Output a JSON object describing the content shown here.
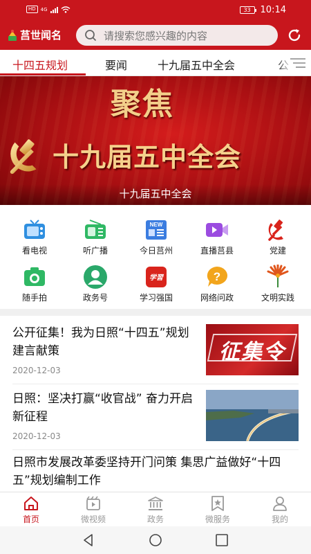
{
  "status_bar": {
    "left_badge": "HD",
    "network": "4G",
    "battery": "33",
    "time": "10:14"
  },
  "header": {
    "app_name": "莒世闻名",
    "search_placeholder": "请搜索您感兴趣的内容"
  },
  "tabs": [
    {
      "label": "十四五规划",
      "active": true
    },
    {
      "label": "要闻",
      "active": false
    },
    {
      "label": "十九届五中全会",
      "active": false
    },
    {
      "label": "公",
      "active": false
    }
  ],
  "banner": {
    "headline": "聚焦",
    "main_text": "十九届五中全会",
    "caption": "十九届五中全会"
  },
  "shortcuts": [
    {
      "label": "看电视",
      "icon": "tv-icon",
      "color": "#2f8fe0"
    },
    {
      "label": "听广播",
      "icon": "radio-icon",
      "color": "#2fb864"
    },
    {
      "label": "今日莒州",
      "icon": "news-icon",
      "color": "#3b7de0",
      "badge": "NEW"
    },
    {
      "label": "直播莒县",
      "icon": "live-video-icon",
      "color": "#9b4ce0"
    },
    {
      "label": "党建",
      "icon": "party-emblem-icon",
      "color": "#d9241c"
    },
    {
      "label": "随手拍",
      "icon": "camera-icon",
      "color": "#2fb864"
    },
    {
      "label": "政务号",
      "icon": "person-icon",
      "color": "#2aa86a"
    },
    {
      "label": "学习强国",
      "icon": "xuexi-icon",
      "color": "#d9241c",
      "badge": "学習"
    },
    {
      "label": "网络问政",
      "icon": "question-icon",
      "color": "#f2a51c"
    },
    {
      "label": "文明实践",
      "icon": "civilization-icon",
      "color": "#e0561c"
    }
  ],
  "news": [
    {
      "title": "公开征集！我为日照“十四五”规划建言献策",
      "date": "2020-12-03",
      "thumb_text": "征集令",
      "thumb": "collection-order-image"
    },
    {
      "title": "日照：坚决打赢“收官战” 奋力开启新征程",
      "date": "2020-12-03",
      "thumb": "coastal-bridge-image"
    },
    {
      "title": "日照市发展改革委坚持开门问策 集思广益做好“十四五”规划编制工作"
    }
  ],
  "bottom_nav": [
    {
      "label": "首页",
      "icon": "home-icon",
      "active": true
    },
    {
      "label": "微视频",
      "icon": "video-clapper-icon",
      "active": false
    },
    {
      "label": "政务",
      "icon": "government-building-icon",
      "active": false
    },
    {
      "label": "微服务",
      "icon": "star-card-icon",
      "active": false
    },
    {
      "label": "我的",
      "icon": "user-icon",
      "active": false
    }
  ],
  "colors": {
    "brand_red": "#c8161d",
    "gold": "#f3cf8a"
  }
}
